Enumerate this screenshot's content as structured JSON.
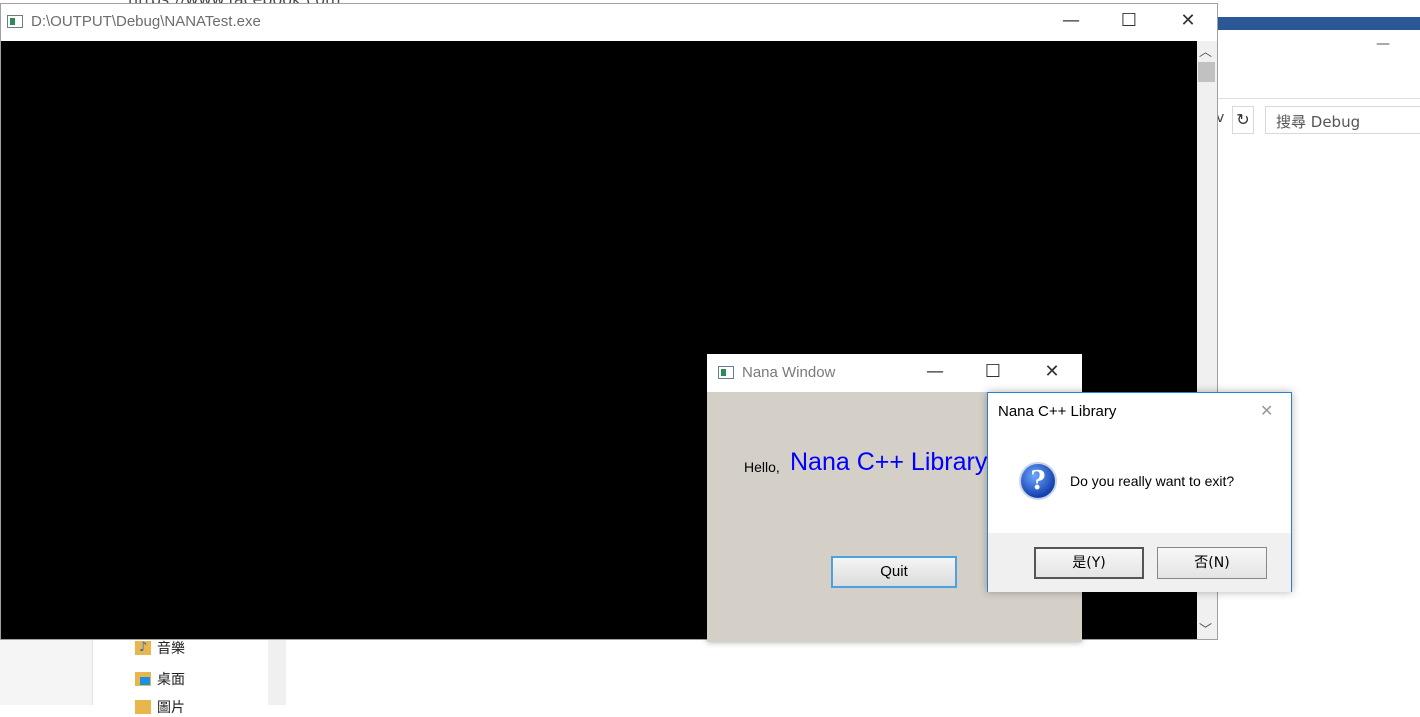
{
  "background_window": {
    "url_fragment": "https://www.facebook.com",
    "minimize_glyph": "—",
    "chevron_glyph": "v",
    "refresh_glyph": "↻",
    "search_placeholder": "搜尋 Debug",
    "sidebar_items": [
      {
        "label": "音樂",
        "icon": "music-folder-icon"
      },
      {
        "label": "桌面",
        "icon": "desktop-folder-icon"
      },
      {
        "label": "圖片",
        "icon": "pictures-folder-icon"
      }
    ]
  },
  "console_window": {
    "title": "D:\\OUTPUT\\Debug\\NANATest.exe",
    "minimize_glyph": "—",
    "maximize_glyph": "☐",
    "close_glyph": "✕",
    "scroll_up_glyph": "︿",
    "scroll_down_glyph": "﹀"
  },
  "nana_window": {
    "title": "Nana Window",
    "minimize_glyph": "—",
    "maximize_glyph": "☐",
    "close_glyph": "✕",
    "hello_text": "Hello,",
    "big_text": "Nana C++ Library",
    "quit_label": "Quit"
  },
  "message_box": {
    "title": "Nana C++ Library",
    "close_glyph": "✕",
    "icon_glyph": "?",
    "message": "Do you really want to exit?",
    "yes_label": "是(Y)",
    "no_label": "否(N)"
  },
  "colors": {
    "console_bg": "#000000",
    "nana_bg": "#d4d0c8",
    "nana_big_text": "#0000ff",
    "msgbox_border": "#2d7fc7",
    "quit_focus_border": "#4aa3df"
  }
}
